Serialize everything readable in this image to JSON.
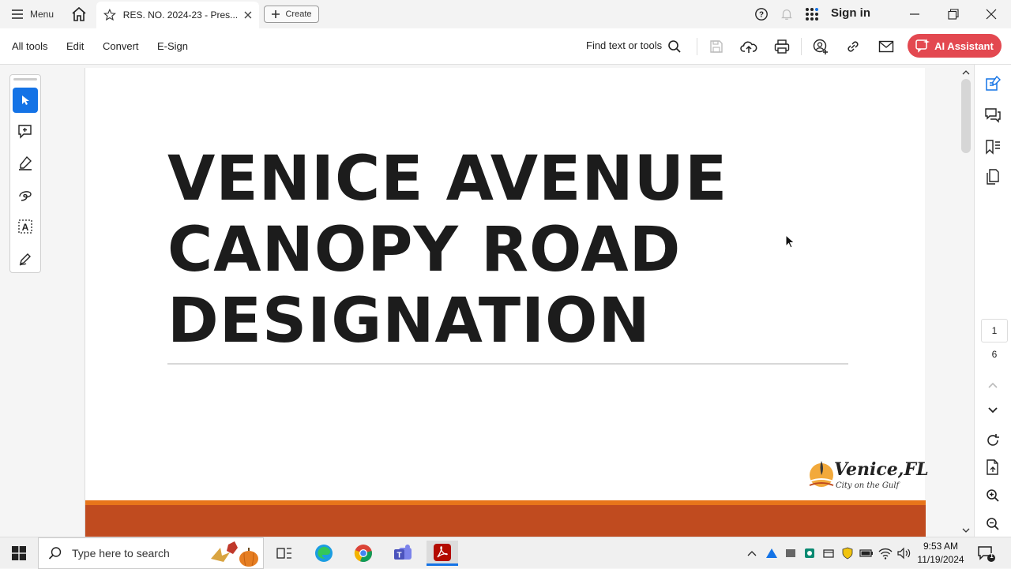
{
  "titlebar": {
    "menu_label": "Menu",
    "tab_title": "RES. NO. 2024-23 - Pres...",
    "create_label": "Create",
    "signin_label": "Sign in"
  },
  "commandbar": {
    "all_tools": "All tools",
    "edit": "Edit",
    "convert": "Convert",
    "esign": "E-Sign",
    "find_label": "Find text or tools",
    "ai_label": "AI Assistant"
  },
  "document": {
    "title_lines": [
      "VENICE AVENUE",
      "CANOPY ROAD",
      "DESIGNATION"
    ],
    "logo_text": "Venice,FL",
    "logo_tagline": "City on the Gulf"
  },
  "pagenav": {
    "current": "1",
    "total": "6"
  },
  "taskbar": {
    "search_placeholder": "Type here to search",
    "time": "9:53 AM",
    "date": "11/19/2024",
    "notification_count": "1"
  },
  "colors": {
    "accent": "#1473e6",
    "ai_button": "#e34850",
    "orange_band": "#c04b1f",
    "orange_stripe": "#e8751a"
  }
}
